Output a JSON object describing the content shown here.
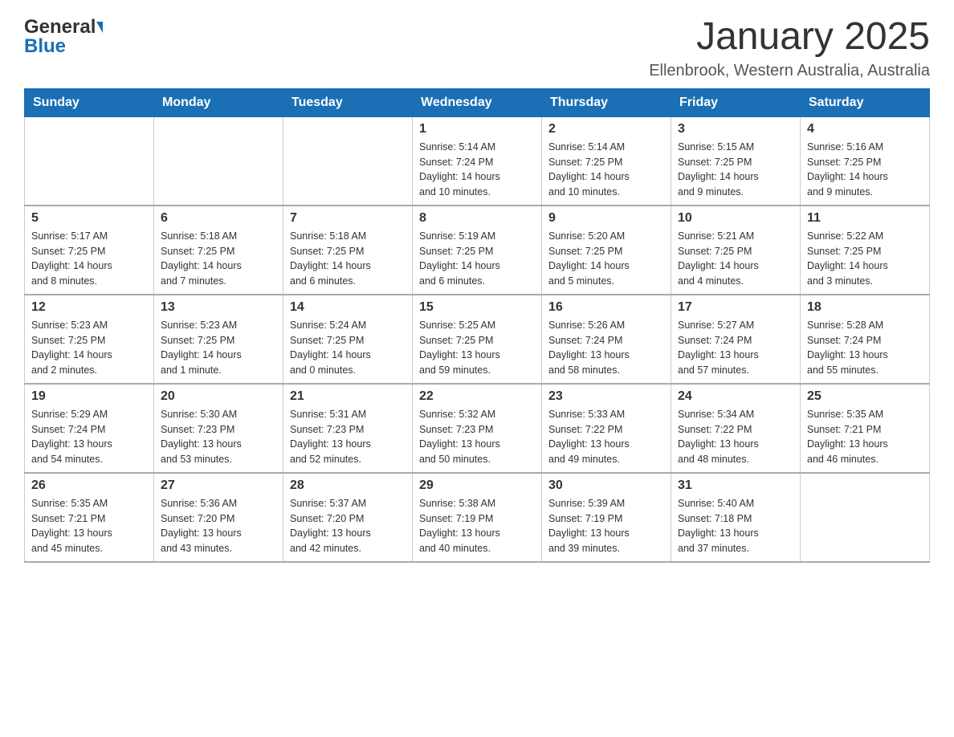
{
  "header": {
    "logo_general": "General",
    "logo_blue": "Blue",
    "month_title": "January 2025",
    "location": "Ellenbrook, Western Australia, Australia"
  },
  "days_of_week": [
    "Sunday",
    "Monday",
    "Tuesday",
    "Wednesday",
    "Thursday",
    "Friday",
    "Saturday"
  ],
  "weeks": [
    [
      {
        "day": "",
        "info": ""
      },
      {
        "day": "",
        "info": ""
      },
      {
        "day": "",
        "info": ""
      },
      {
        "day": "1",
        "info": "Sunrise: 5:14 AM\nSunset: 7:24 PM\nDaylight: 14 hours\nand 10 minutes."
      },
      {
        "day": "2",
        "info": "Sunrise: 5:14 AM\nSunset: 7:25 PM\nDaylight: 14 hours\nand 10 minutes."
      },
      {
        "day": "3",
        "info": "Sunrise: 5:15 AM\nSunset: 7:25 PM\nDaylight: 14 hours\nand 9 minutes."
      },
      {
        "day": "4",
        "info": "Sunrise: 5:16 AM\nSunset: 7:25 PM\nDaylight: 14 hours\nand 9 minutes."
      }
    ],
    [
      {
        "day": "5",
        "info": "Sunrise: 5:17 AM\nSunset: 7:25 PM\nDaylight: 14 hours\nand 8 minutes."
      },
      {
        "day": "6",
        "info": "Sunrise: 5:18 AM\nSunset: 7:25 PM\nDaylight: 14 hours\nand 7 minutes."
      },
      {
        "day": "7",
        "info": "Sunrise: 5:18 AM\nSunset: 7:25 PM\nDaylight: 14 hours\nand 6 minutes."
      },
      {
        "day": "8",
        "info": "Sunrise: 5:19 AM\nSunset: 7:25 PM\nDaylight: 14 hours\nand 6 minutes."
      },
      {
        "day": "9",
        "info": "Sunrise: 5:20 AM\nSunset: 7:25 PM\nDaylight: 14 hours\nand 5 minutes."
      },
      {
        "day": "10",
        "info": "Sunrise: 5:21 AM\nSunset: 7:25 PM\nDaylight: 14 hours\nand 4 minutes."
      },
      {
        "day": "11",
        "info": "Sunrise: 5:22 AM\nSunset: 7:25 PM\nDaylight: 14 hours\nand 3 minutes."
      }
    ],
    [
      {
        "day": "12",
        "info": "Sunrise: 5:23 AM\nSunset: 7:25 PM\nDaylight: 14 hours\nand 2 minutes."
      },
      {
        "day": "13",
        "info": "Sunrise: 5:23 AM\nSunset: 7:25 PM\nDaylight: 14 hours\nand 1 minute."
      },
      {
        "day": "14",
        "info": "Sunrise: 5:24 AM\nSunset: 7:25 PM\nDaylight: 14 hours\nand 0 minutes."
      },
      {
        "day": "15",
        "info": "Sunrise: 5:25 AM\nSunset: 7:25 PM\nDaylight: 13 hours\nand 59 minutes."
      },
      {
        "day": "16",
        "info": "Sunrise: 5:26 AM\nSunset: 7:24 PM\nDaylight: 13 hours\nand 58 minutes."
      },
      {
        "day": "17",
        "info": "Sunrise: 5:27 AM\nSunset: 7:24 PM\nDaylight: 13 hours\nand 57 minutes."
      },
      {
        "day": "18",
        "info": "Sunrise: 5:28 AM\nSunset: 7:24 PM\nDaylight: 13 hours\nand 55 minutes."
      }
    ],
    [
      {
        "day": "19",
        "info": "Sunrise: 5:29 AM\nSunset: 7:24 PM\nDaylight: 13 hours\nand 54 minutes."
      },
      {
        "day": "20",
        "info": "Sunrise: 5:30 AM\nSunset: 7:23 PM\nDaylight: 13 hours\nand 53 minutes."
      },
      {
        "day": "21",
        "info": "Sunrise: 5:31 AM\nSunset: 7:23 PM\nDaylight: 13 hours\nand 52 minutes."
      },
      {
        "day": "22",
        "info": "Sunrise: 5:32 AM\nSunset: 7:23 PM\nDaylight: 13 hours\nand 50 minutes."
      },
      {
        "day": "23",
        "info": "Sunrise: 5:33 AM\nSunset: 7:22 PM\nDaylight: 13 hours\nand 49 minutes."
      },
      {
        "day": "24",
        "info": "Sunrise: 5:34 AM\nSunset: 7:22 PM\nDaylight: 13 hours\nand 48 minutes."
      },
      {
        "day": "25",
        "info": "Sunrise: 5:35 AM\nSunset: 7:21 PM\nDaylight: 13 hours\nand 46 minutes."
      }
    ],
    [
      {
        "day": "26",
        "info": "Sunrise: 5:35 AM\nSunset: 7:21 PM\nDaylight: 13 hours\nand 45 minutes."
      },
      {
        "day": "27",
        "info": "Sunrise: 5:36 AM\nSunset: 7:20 PM\nDaylight: 13 hours\nand 43 minutes."
      },
      {
        "day": "28",
        "info": "Sunrise: 5:37 AM\nSunset: 7:20 PM\nDaylight: 13 hours\nand 42 minutes."
      },
      {
        "day": "29",
        "info": "Sunrise: 5:38 AM\nSunset: 7:19 PM\nDaylight: 13 hours\nand 40 minutes."
      },
      {
        "day": "30",
        "info": "Sunrise: 5:39 AM\nSunset: 7:19 PM\nDaylight: 13 hours\nand 39 minutes."
      },
      {
        "day": "31",
        "info": "Sunrise: 5:40 AM\nSunset: 7:18 PM\nDaylight: 13 hours\nand 37 minutes."
      },
      {
        "day": "",
        "info": ""
      }
    ]
  ]
}
